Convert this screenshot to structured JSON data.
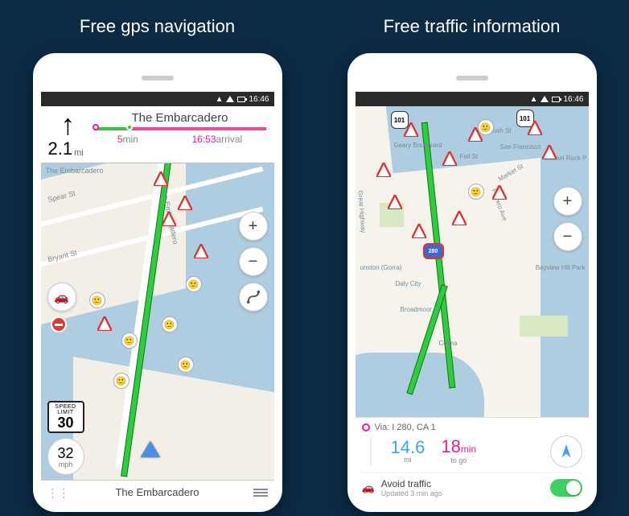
{
  "panels": {
    "left_title": "Free gps navigation",
    "right_title": "Free traffic information"
  },
  "statusbar": {
    "time": "16:46"
  },
  "nav": {
    "destination": "The Embarcadero",
    "distance_value": "2.1",
    "distance_unit": "mi",
    "eta_minutes_value": "5",
    "eta_minutes_unit": "min",
    "arrival_time": "16:53",
    "arrival_label": "arrival",
    "footer_street": "The Embarcadero",
    "speed_limit_label_top": "SPEED",
    "speed_limit_label_bot": "LIMIT",
    "speed_limit_value": "30",
    "speed_current_value": "32",
    "speed_current_unit": "mph",
    "streets": {
      "embarcadero": "The Embarcadero",
      "bryant": "Bryant St",
      "spear": "Spear St"
    }
  },
  "buttons": {
    "zoom_in": "+",
    "zoom_out": "−"
  },
  "traffic": {
    "via_label": "Via: I 280, CA 1",
    "distance_value": "14.6",
    "distance_unit": "mi",
    "time_value": "18",
    "time_unit": "min",
    "time_sub": "to go",
    "avoid_label": "Avoid traffic",
    "avoid_sub": "Updated 3 min ago",
    "avoid_on": true,
    "highways": {
      "hwy101": "101",
      "hwy280": "280"
    },
    "labels": {
      "geary": "Geary Boulevard",
      "fell": "Fell St",
      "sf": "San Francisco",
      "bush": "Bush St",
      "market": "Market St",
      "gsh": "Great Highway",
      "potrero": "Potrero Ave",
      "broadmoor": "Broadmoor",
      "colma": "Colma",
      "mussel": "Mussel Rock P",
      "daly": "Daly City",
      "bayview": "Bayview Hill Park",
      "unston": "unston (Gorra)"
    }
  }
}
